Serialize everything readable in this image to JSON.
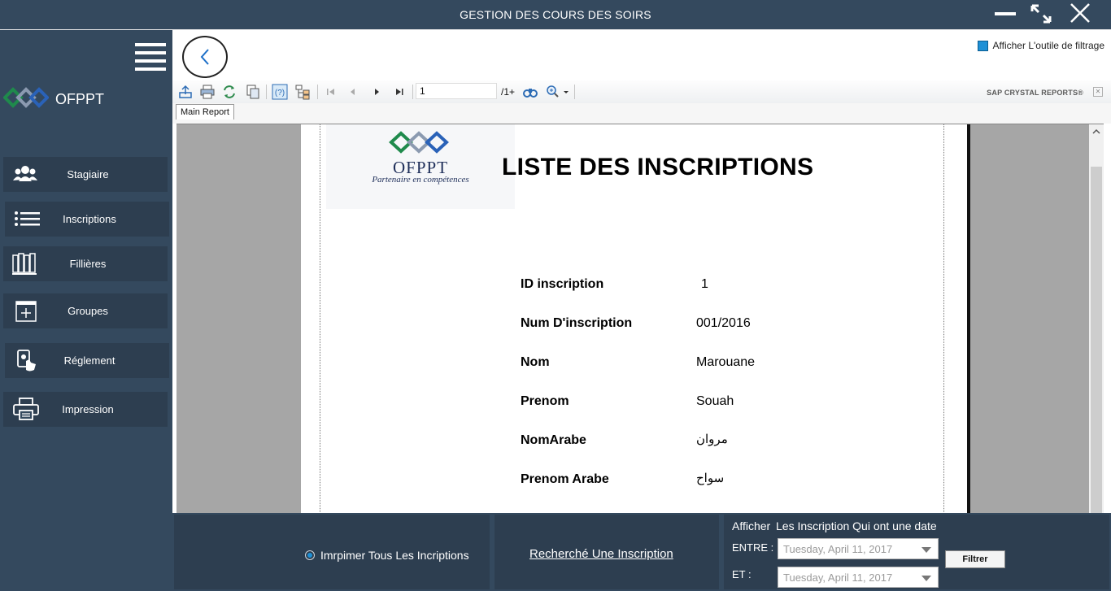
{
  "window": {
    "title": "GESTION DES COURS DES SOIRS"
  },
  "sidebar": {
    "brand": "OFPPT",
    "items": [
      {
        "label": "Stagiaire",
        "icon": "users-icon"
      },
      {
        "label": "Inscriptions",
        "icon": "list-icon"
      },
      {
        "label": "Fillières",
        "icon": "books-icon"
      },
      {
        "label": "Groupes",
        "icon": "add-box-icon"
      },
      {
        "label": "Réglement",
        "icon": "payment-icon"
      },
      {
        "label": "Impression",
        "icon": "printer-icon"
      }
    ]
  },
  "filter_tool": {
    "label": "Afficher L'outile de filtrage",
    "checked": true
  },
  "viewer": {
    "page_number": "1",
    "page_total": "/1+",
    "brand": "SAP CRYSTAL REPORTS®",
    "tab": "Main Report"
  },
  "report": {
    "logo_text": "OFPPT",
    "logo_tagline": "Partenaire en compétences",
    "title": "LISTE DES INSCRIPTIONS",
    "fields": [
      {
        "label": "ID inscription",
        "value": "1"
      },
      {
        "label": "Num D'inscription",
        "value": "001/2016"
      },
      {
        "label": "Nom",
        "value": "Marouane"
      },
      {
        "label": "Prenom",
        "value": "Souah"
      },
      {
        "label": "NomArabe",
        "value": "مروان"
      },
      {
        "label": "Prenom Arabe",
        "value": "سواح"
      }
    ]
  },
  "bottom": {
    "print_all": "Imrpimer Tous Les Incriptions",
    "search": "Recherché Une Inscription",
    "filter_heading_1": "Afficher",
    "filter_heading_2": "Les Inscription Qui ont une date",
    "between_label": "ENTRE :",
    "and_label": "ET :",
    "date_from": "Tuesday,  April  11, 2017",
    "date_to": "Tuesday,  April  11, 2017",
    "filter_button": "Filtrer"
  },
  "colors": {
    "sidebar_bg": "#34495e",
    "nav_item_bg": "#2d3e50",
    "accent": "#1e90d6"
  }
}
